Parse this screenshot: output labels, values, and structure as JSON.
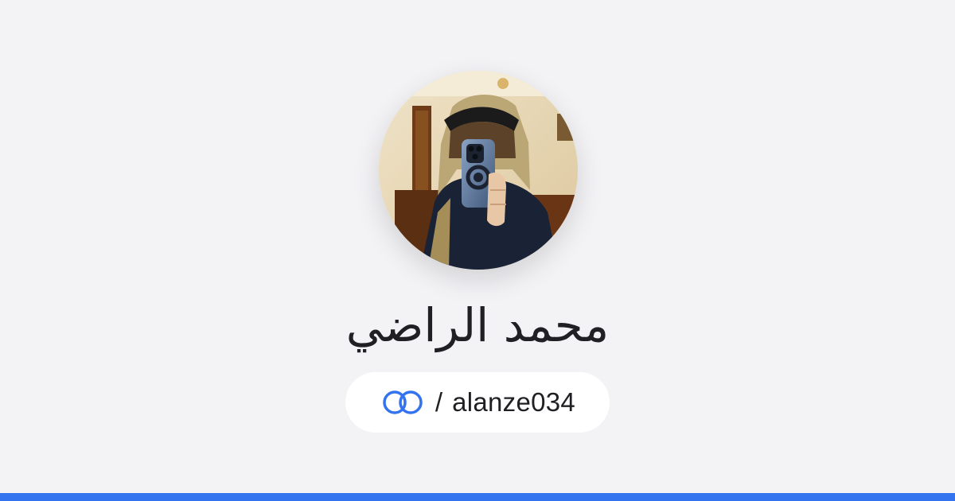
{
  "profile": {
    "name": "محمد الراضي",
    "separator": "/",
    "username": "alanze034",
    "avatar_icon": "profile-photo",
    "link_icon": "linked-rings-icon"
  },
  "colors": {
    "background": "#f3f3f6",
    "pill_background": "#ffffff",
    "accent": "#3373f0",
    "text": "#1f1f24"
  }
}
